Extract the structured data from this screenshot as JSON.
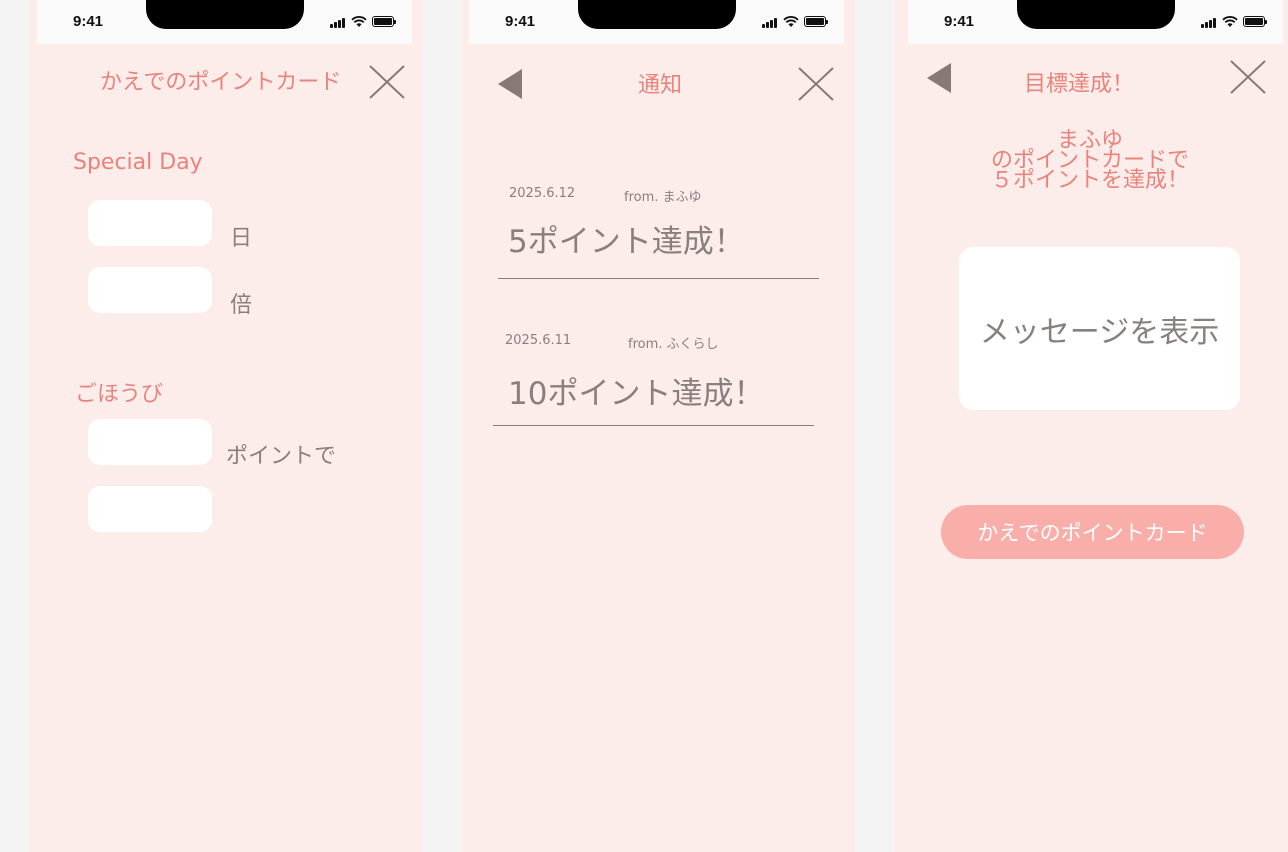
{
  "status_bar": {
    "time": "9:41"
  },
  "screen1": {
    "title": "かえでのポイントカード",
    "special_day": {
      "label": "Special Day",
      "day_value": "",
      "day_unit": "日",
      "multiplier_value": "",
      "multiplier_unit": "倍"
    },
    "reward": {
      "label": "ごほうび",
      "points_value": "",
      "points_unit": "ポイントで",
      "reward_value": ""
    }
  },
  "screen2": {
    "title": "通知",
    "notifications": [
      {
        "date": "2025.6.12",
        "from": "from. まふゆ",
        "title": "5ポイント達成！"
      },
      {
        "date": "2025.6.11",
        "from": "from. ふくらし",
        "title": "10ポイント達成！"
      }
    ]
  },
  "screen3": {
    "title": "目標達成！",
    "message_lines": [
      "まふゆ",
      "のポイントカードで",
      "５ポイントを達成！"
    ],
    "show_message_label": "メッセージを表示",
    "card_button_label": "かえでのポイントカード"
  }
}
